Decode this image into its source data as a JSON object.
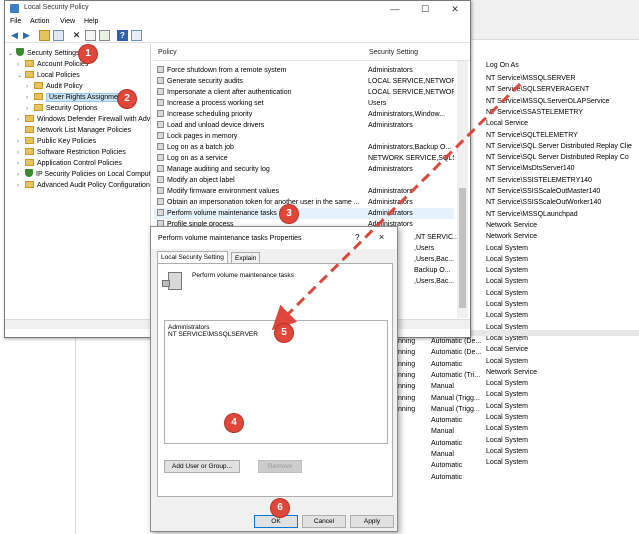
{
  "lsp": {
    "title": "Local Security Policy",
    "menu": [
      "File",
      "Action",
      "View",
      "Help"
    ],
    "columns": {
      "policy": "Policy",
      "setting": "Security Setting"
    },
    "tree": [
      {
        "label": "Security Settings",
        "level": 0,
        "expanded": true,
        "icon": "shield"
      },
      {
        "label": "Account Policies",
        "level": 1,
        "expanded": false,
        "icon": "folder"
      },
      {
        "label": "Local Policies",
        "level": 1,
        "expanded": true,
        "icon": "folder"
      },
      {
        "label": "Audit Policy",
        "level": 2,
        "expanded": false,
        "icon": "folder"
      },
      {
        "label": "User Rights Assignment",
        "level": 2,
        "expanded": false,
        "icon": "folder",
        "selected": true
      },
      {
        "label": "Security Options",
        "level": 2,
        "expanded": false,
        "icon": "folder"
      },
      {
        "label": "Windows Defender Firewall with Advan",
        "level": 1,
        "expanded": false,
        "icon": "folder"
      },
      {
        "label": "Network List Manager Policies",
        "level": 1,
        "expanded": null,
        "icon": "folder"
      },
      {
        "label": "Public Key Policies",
        "level": 1,
        "expanded": false,
        "icon": "folder"
      },
      {
        "label": "Software Restriction Policies",
        "level": 1,
        "expanded": false,
        "icon": "folder"
      },
      {
        "label": "Application Control Policies",
        "level": 1,
        "expanded": false,
        "icon": "folder"
      },
      {
        "label": "IP Security Policies on Local Computer",
        "level": 1,
        "expanded": false,
        "icon": "shield"
      },
      {
        "label": "Advanced Audit Policy Configuration",
        "level": 1,
        "expanded": false,
        "icon": "folder"
      }
    ],
    "policies": [
      {
        "name": "Force shutdown from a remote system",
        "setting": "Administrators"
      },
      {
        "name": "Generate security audits",
        "setting": "LOCAL SERVICE,NETWOR..."
      },
      {
        "name": "Impersonate a client after authentication",
        "setting": "LOCAL SERVICE,NETWOR..."
      },
      {
        "name": "Increase a process working set",
        "setting": "Users"
      },
      {
        "name": "Increase scheduling priority",
        "setting": "Administrators,Window..."
      },
      {
        "name": "Load and unload device drivers",
        "setting": "Administrators"
      },
      {
        "name": "Lock pages in memory",
        "setting": ""
      },
      {
        "name": "Log on as a batch job",
        "setting": "Administrators,Backup O..."
      },
      {
        "name": "Log on as a service",
        "setting": "NETWORK SERVICE,SQLS..."
      },
      {
        "name": "Manage auditing and security log",
        "setting": "Administrators"
      },
      {
        "name": "Modify an object label",
        "setting": ""
      },
      {
        "name": "Modify firmware environment values",
        "setting": "Administrators"
      },
      {
        "name": "Obtain an impersonation token for another user in the same ...",
        "setting": "Administrators"
      },
      {
        "name": "Perform volume maintenance tasks",
        "setting": "Administrators",
        "highlight": true
      },
      {
        "name": "Profile single process",
        "setting": "Administrators"
      }
    ],
    "behind_dialog_settings": [
      ",NT SERVIC...",
      ",Users",
      ",Users,Bac...",
      "Backup O...",
      ",Users,Bac..."
    ]
  },
  "dialog": {
    "title": "Perform volume maintenance tasks Properties",
    "help": "?",
    "close": "×",
    "tabs": [
      "Local Security Setting",
      "Explain"
    ],
    "policy_title": "Perform volume maintenance tasks",
    "accounts": [
      "Administrators",
      "NT SERVICE\\MSSQLSERVER"
    ],
    "add_button": "Add User or Group...",
    "remove_button": "Remove",
    "ok_button": "OK",
    "cancel_button": "Cancel",
    "apply_button": "Apply"
  },
  "services": {
    "log_on_as_header": "Log On As",
    "log_on_as": [
      "NT Service\\MSSQLSERVER",
      "NT Service\\SQLSERVERAGENT",
      "NT Service\\MSSQLServerOLAPService",
      "NT Service\\SSASTELEMETRY",
      "Local Service",
      "NT Service\\SQLTELEMETRY",
      "NT Service\\SQL Server Distributed Replay Clie",
      "NT Service\\SQL Server Distributed Replay Co",
      "NT Service\\MsDtsServer140",
      "NT Service\\SSISTELEMETRY140",
      "NT Service\\SSISScaleOutMaster140",
      "NT Service\\SSISScaleOutWorker140",
      "NT Service\\MSSQLaunchpad",
      "Network Service",
      "Network Service",
      "Local System",
      "Local System",
      "Local System",
      "Local System",
      "Local System",
      "Local System",
      "Local System",
      "Local System",
      "Local System",
      "Local Service",
      "Local System",
      "Network Service",
      "Local System",
      "Local System",
      "Local System",
      "Local System",
      "Local System",
      "Local System",
      "Local System",
      "Local System"
    ],
    "status_partial": [
      "nning",
      "nning",
      "nning",
      "nning",
      "nning",
      "nning",
      "nning"
    ],
    "startup_type": [
      "Automatic (De...",
      "Automatic (De...",
      "Automatic",
      "Automatic (Tri...",
      "Manual",
      "Manual (Trigg...",
      "Manual (Trigg...",
      "Automatic",
      "Manual",
      "Automatic",
      "Manual",
      "Automatic",
      "Automatic"
    ]
  },
  "badges": [
    "1",
    "2",
    "3",
    "4",
    "5",
    "6"
  ],
  "colors": {
    "annotation": "#e0463a",
    "selection": "#cce4f7",
    "accent": "#0078d7"
  }
}
